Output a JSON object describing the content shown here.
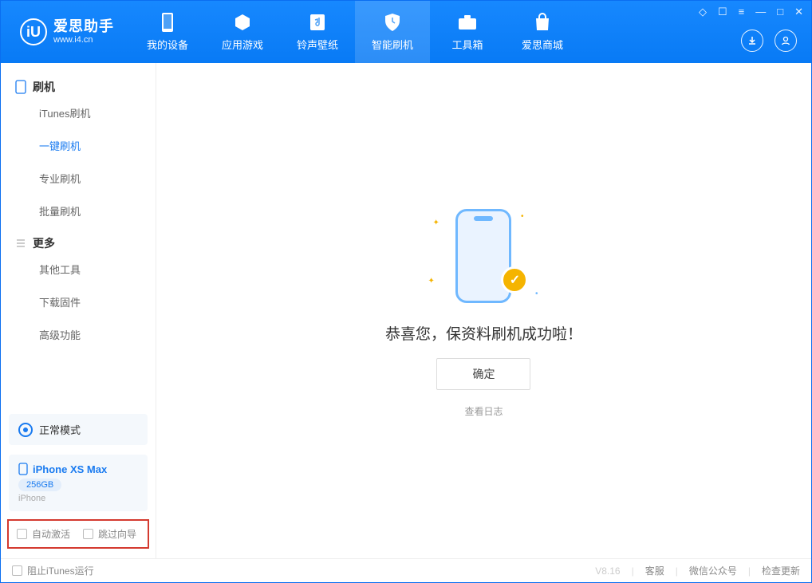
{
  "app": {
    "title": "爱思助手",
    "site": "www.i4.cn"
  },
  "nav": {
    "items": [
      {
        "label": "我的设备"
      },
      {
        "label": "应用游戏"
      },
      {
        "label": "铃声壁纸"
      },
      {
        "label": "智能刷机"
      },
      {
        "label": "工具箱"
      },
      {
        "label": "爱思商城"
      }
    ]
  },
  "sidebar": {
    "group1": {
      "title": "刷机"
    },
    "group1_items": [
      {
        "label": "iTunes刷机"
      },
      {
        "label": "一键刷机"
      },
      {
        "label": "专业刷机"
      },
      {
        "label": "批量刷机"
      }
    ],
    "group2": {
      "title": "更多"
    },
    "group2_items": [
      {
        "label": "其他工具"
      },
      {
        "label": "下载固件"
      },
      {
        "label": "高级功能"
      }
    ],
    "mode_label": "正常模式",
    "device": {
      "name": "iPhone XS Max",
      "storage": "256GB",
      "type": "iPhone"
    },
    "opt_auto_activate": "自动激活",
    "opt_skip_guide": "跳过向导"
  },
  "main": {
    "success_message": "恭喜您，保资料刷机成功啦！",
    "ok_button": "确定",
    "view_log": "查看日志"
  },
  "footer": {
    "block_itunes": "阻止iTunes运行",
    "version": "V8.16",
    "link_support": "客服",
    "link_wechat": "微信公众号",
    "link_update": "检查更新"
  }
}
